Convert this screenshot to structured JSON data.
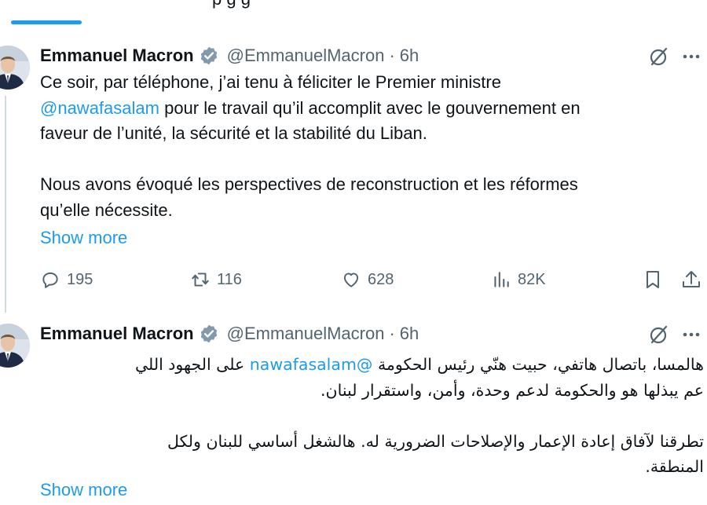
{
  "page": {
    "top_text": "p                    g  g"
  },
  "tweets": [
    {
      "author": "Emmanuel Macron",
      "handle": "@EmmanuelMacron",
      "separator": "·",
      "time": "6h",
      "lines": [
        {
          "text": "Ce soir, par téléphone, j’ai tenu à féliciter le Premier ministre"
        },
        {
          "mention": "@nawafasalam",
          "text": " pour le travail qu’il accomplit avec le gouvernement en"
        },
        {
          "text": "faveur de l’unité, la sécurité et la stabilité du Liban."
        },
        {
          "text": ""
        },
        {
          "text": "Nous avons évoqué les perspectives de reconstruction et les réformes"
        },
        {
          "text": "qu’elle nécessite."
        }
      ],
      "show_more": "Show more",
      "stats": {
        "replies": "195",
        "reposts": "116",
        "likes": "628",
        "views": "82K"
      }
    },
    {
      "author": "Emmanuel Macron",
      "handle": "@EmmanuelMacron",
      "separator": "·",
      "time": "6h",
      "rtl_lines": [
        {
          "before": "هالمسا، باتصال هاتفي، حبيت هنّي رئيس الحكومة ",
          "mention": "@nawafasalam",
          "after": " على الجهود اللي"
        },
        {
          "text": "عم يبذلها هو والحكومة لدعم وحدة، وأمن، واستقرار لبنان."
        },
        {
          "text": ""
        },
        {
          "text": "تطرقنا لآفاق إعادة الإعمار والإصلاحات الضرورية له. هالشغل أساسي للبنان ولكل"
        },
        {
          "text": "المنطقة."
        }
      ],
      "show_more": "Show more"
    }
  ],
  "colors": {
    "accent": "#1d9bf0",
    "secondary_text": "#536471",
    "primary_text": "#0f1419"
  },
  "icons": [
    "verified-badge-icon",
    "grok-icon",
    "more-icon",
    "reply-icon",
    "repost-icon",
    "like-icon",
    "views-icon",
    "bookmark-icon",
    "share-icon"
  ]
}
